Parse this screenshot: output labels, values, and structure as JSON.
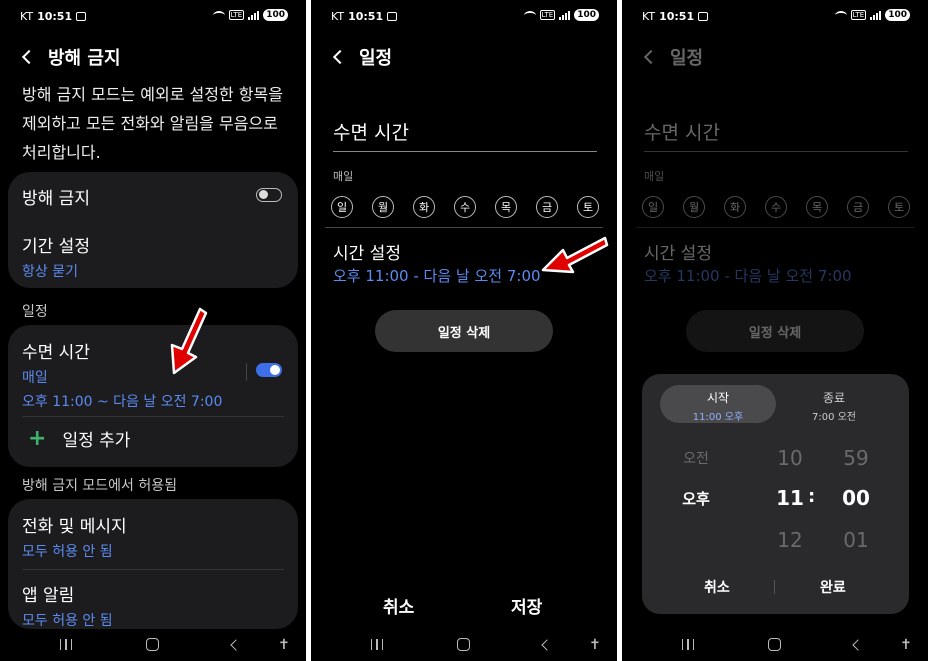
{
  "status": {
    "carrier": "KT",
    "time": "10:51",
    "battery": "100"
  },
  "panel1": {
    "title": "방해 금지",
    "description": "방해 금지 모드는 예외로 설정한 항목을 제외하고 모든 전화와 알림을 무음으로 처리합니다.",
    "dnd_label": "방해 금지",
    "dnd_on": false,
    "duration_label": "기간 설정",
    "duration_value": "항상 묻기",
    "schedule_section": "일정",
    "sleep_title": "수면 시간",
    "sleep_repeat": "매일",
    "sleep_time": "오후 11:00 ~ 다음 날 오전 7:00",
    "sleep_on": true,
    "add_schedule": "일정 추가",
    "allowed_section": "방해 금지 모드에서 허용됨",
    "calls_label": "전화 및 메시지",
    "calls_value": "모두 허용 안 됨",
    "apps_label": "앱 알림",
    "apps_value": "모두 허용 안 됨"
  },
  "panel2": {
    "title": "일정",
    "name": "수면 시간",
    "repeat_label": "매일",
    "days": [
      "일",
      "월",
      "화",
      "수",
      "목",
      "금",
      "토"
    ],
    "time_title": "시간 설정",
    "time_value": "오후 11:00 - 다음 날 오전 7:00",
    "delete_label": "일정 삭제",
    "cancel_label": "취소",
    "save_label": "저장"
  },
  "panel3": {
    "start_tab": "시작",
    "start_value": "11:00 오후",
    "end_tab": "종료",
    "end_value": "7:00 오전",
    "ampm": {
      "prev": "오전",
      "current": "오후"
    },
    "hour": {
      "prev": "10",
      "current": "11",
      "next": "12"
    },
    "minute": {
      "prev": "59",
      "current": "00",
      "next": "01"
    },
    "separator": ":",
    "cancel_label": "취소",
    "done_label": "완료"
  },
  "colors": {
    "accent_blue": "#5b8bf0",
    "toggle_on": "#3c6fe8",
    "arrow_red": "#e00000"
  }
}
